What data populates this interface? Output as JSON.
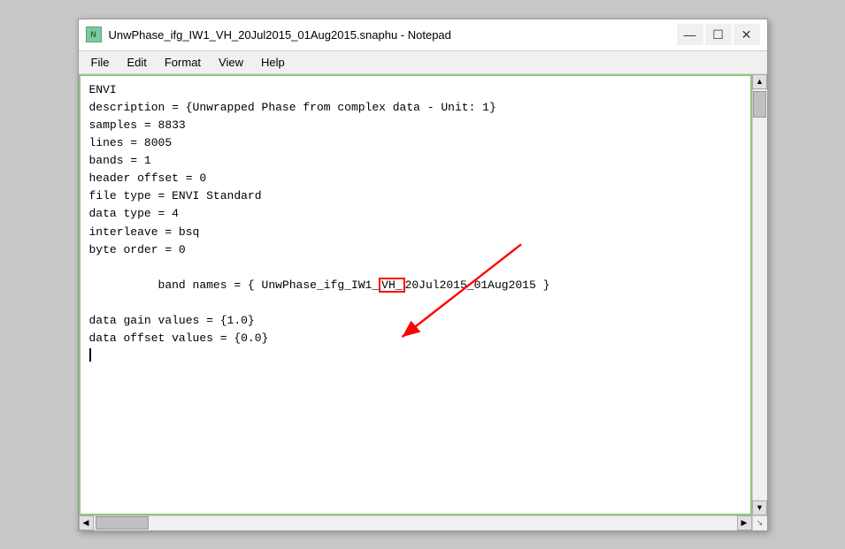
{
  "window": {
    "title": "UnwPhase_ifg_IW1_VH_20Jul2015_01Aug2015.snaphu - Notepad",
    "icon_label": "N"
  },
  "title_buttons": {
    "minimize": "—",
    "maximize": "☐",
    "close": "✕"
  },
  "menu": {
    "items": [
      "File",
      "Edit",
      "Format",
      "View",
      "Help"
    ]
  },
  "content": {
    "lines": [
      "ENVI",
      "description = {Unwrapped Phase from complex data - Unit: 1}",
      "samples = 8833",
      "lines = 8005",
      "bands = 1",
      "header offset = 0",
      "file type = ENVI Standard",
      "data type = 4",
      "interleave = bsq",
      "byte order = 0",
      "band names = { UnwPhase_ifg_IW1_VH_20Jul2015_01Aug2015 }",
      "data gain values = {1.0}",
      "data offset values = {0.0}"
    ],
    "highlighted_text": "VH_",
    "cursor_line": "",
    "band_names_pre": "band names = { UnwPhase_ifg_IW1_",
    "band_names_highlight": "VH_",
    "band_names_post": "20Jul2015_01Aug2015 }"
  }
}
